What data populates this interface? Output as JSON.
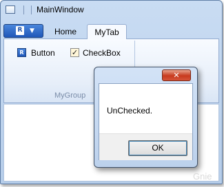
{
  "window": {
    "title": "MainWindow"
  },
  "ribbon": {
    "app_button": {
      "logo": "R",
      "caret": "▼"
    },
    "tabs": [
      {
        "label": "Home"
      },
      {
        "label": "MyTab",
        "selected": true
      }
    ],
    "group": {
      "label": "MyGroup",
      "button": {
        "label": "Button",
        "icon": "R"
      },
      "checkbox": {
        "label": "CheckBox",
        "checked": true,
        "check_glyph": "✓"
      }
    }
  },
  "dialog": {
    "close_glyph": "✕",
    "message": "UnChecked.",
    "ok_label": "OK"
  },
  "watermark": "Gnie",
  "colors": {
    "accent": "#1f57b8",
    "close_button": "#c73a1e",
    "frame": "#b6cde9"
  }
}
